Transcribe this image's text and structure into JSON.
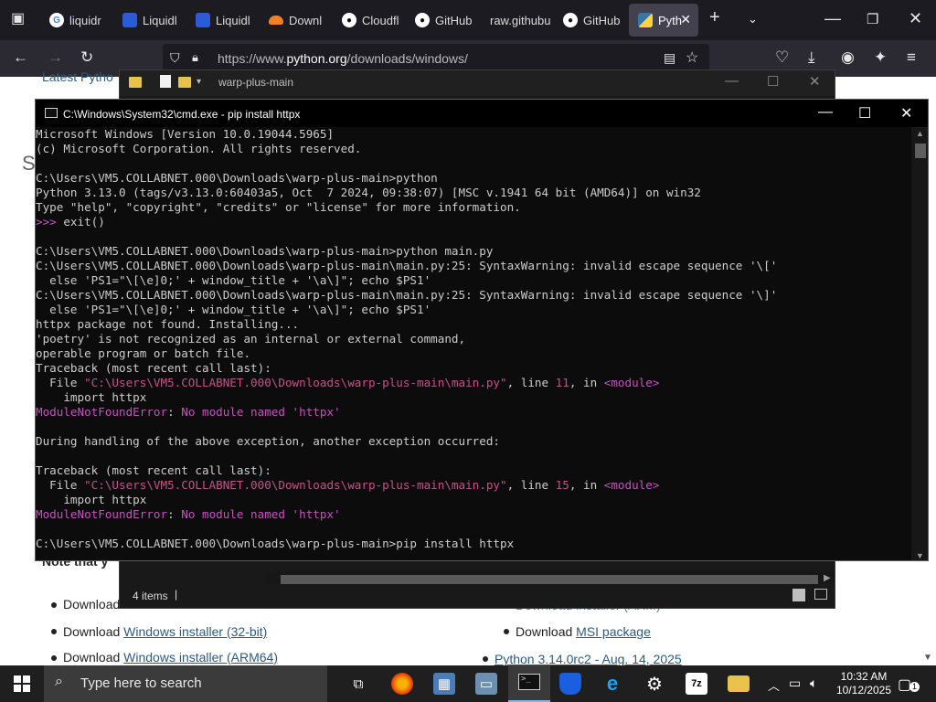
{
  "browser": {
    "tabs": [
      {
        "label": "liquidr",
        "icon": "google-icon"
      },
      {
        "label": "Liquidl",
        "icon": "shield-icon"
      },
      {
        "label": "Liquidl",
        "icon": "shield-icon"
      },
      {
        "label": "Downl",
        "icon": "cloud-icon"
      },
      {
        "label": "Cloudfl",
        "icon": "github-icon"
      },
      {
        "label": "GitHub",
        "icon": "github-icon"
      },
      {
        "label": "raw.githubu",
        "icon": ""
      },
      {
        "label": "GitHub",
        "icon": "github-icon"
      },
      {
        "label": "Pyth",
        "icon": "python-icon"
      }
    ],
    "url_prefix": "https://www.",
    "url_domain": "python.org",
    "url_path": "/downloads/windows/"
  },
  "page": {
    "top_link": "Latest Pytho",
    "letter_s": "S",
    "note": "Note that y",
    "download_prefix": "Download",
    "links": [
      "Windows installer (32-bit)",
      "Windows installer (ARM64)",
      "MSI package"
    ],
    "partial_link": "Download installer (ARM)",
    "release": "Python 3.14.0rc2 - Aug. 14, 2025"
  },
  "explorer": {
    "title": "warp-plus-main",
    "status": "4 items"
  },
  "cmd": {
    "title": "C:\\Windows\\System32\\cmd.exe - pip  install httpx",
    "lines": [
      {
        "t": "Microsoft Windows [Version 10.0.19044.5965]"
      },
      {
        "t": "(c) Microsoft Corporation. All rights reserved."
      },
      {
        "t": ""
      },
      {
        "t": "C:\\Users\\VM5.COLLABNET.000\\Downloads\\warp-plus-main>python"
      },
      {
        "t": "Python 3.13.0 (tags/v3.13.0:60403a5, Oct  7 2024, 09:38:07) [MSC v.1941 64 bit (AMD64)] on win32"
      },
      {
        "t": "Type \"help\", \"copyright\", \"credits\" or \"license\" for more information."
      },
      {
        "p": ">>> ",
        "t": "exit()"
      },
      {
        "t": ""
      },
      {
        "t": "C:\\Users\\VM5.COLLABNET.000\\Downloads\\warp-plus-main>python main.py"
      },
      {
        "t": "C:\\Users\\VM5.COLLABNET.000\\Downloads\\warp-plus-main\\main.py:25: SyntaxWarning: invalid escape sequence '\\['"
      },
      {
        "t": "  else 'PS1=\"\\[\\e]0;' + window_title + '\\a\\]\"; echo $PS1'"
      },
      {
        "t": "C:\\Users\\VM5.COLLABNET.000\\Downloads\\warp-plus-main\\main.py:25: SyntaxWarning: invalid escape sequence '\\]'"
      },
      {
        "t": "  else 'PS1=\"\\[\\e]0;' + window_title + '\\a\\]\"; echo $PS1'"
      },
      {
        "t": "httpx package not found. Installing..."
      },
      {
        "t": "'poetry' is not recognized as an internal or external command,"
      },
      {
        "t": "operable program or batch file."
      },
      {
        "t": "Traceback (most recent call last):"
      },
      {
        "t": "  File ",
        "path": "\"C:\\Users\\VM5.COLLABNET.000\\Downloads\\warp-plus-main\\main.py\"",
        "mid": ", line ",
        "num": "11",
        "in": ", in ",
        "mod": "<module>"
      },
      {
        "t": "    import httpx"
      },
      {
        "err": "ModuleNotFoundError",
        "t": ": ",
        "msg": "No module named 'httpx'"
      },
      {
        "t": ""
      },
      {
        "t": "During handling of the above exception, another exception occurred:"
      },
      {
        "t": ""
      },
      {
        "t": "Traceback (most recent call last):"
      },
      {
        "t": "  File ",
        "path": "\"C:\\Users\\VM5.COLLABNET.000\\Downloads\\warp-plus-main\\main.py\"",
        "mid": ", line ",
        "num": "15",
        "in": ", in ",
        "mod": "<module>"
      },
      {
        "t": "    import httpx"
      },
      {
        "err": "ModuleNotFoundError",
        "t": ": ",
        "msg": "No module named 'httpx'"
      },
      {
        "t": ""
      },
      {
        "t": "C:\\Users\\VM5.COLLABNET.000\\Downloads\\warp-plus-main>pip install httpx"
      }
    ]
  },
  "taskbar": {
    "search_placeholder": "Type here to search",
    "time": "10:32 AM",
    "date": "10/12/2025",
    "notification_count": "1"
  },
  "colors": {
    "accent": "#76b9ed",
    "error_magenta": "#c850c0",
    "path_pink": "#c8508a"
  }
}
